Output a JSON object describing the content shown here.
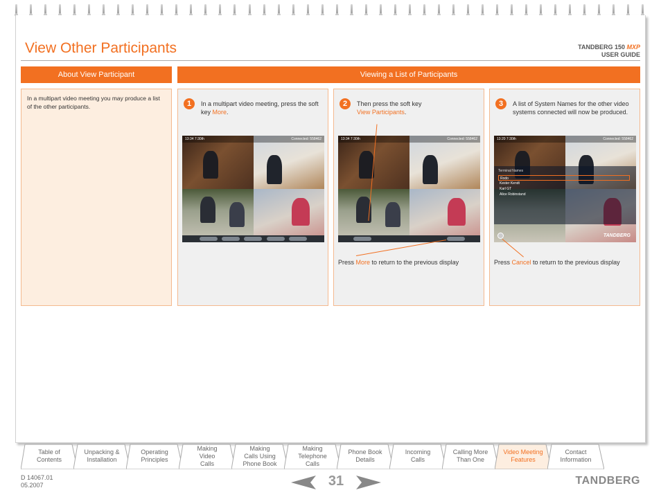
{
  "header": {
    "title": "View Other Participants",
    "brand_line1_prefix": "TANDBERG 150 ",
    "brand_line1_mxp": "MXP",
    "brand_line2": "USER GUIDE"
  },
  "left_panel": {
    "heading": "About View Participant",
    "text": "In a multipart video meeting you may produce a list of the other participants."
  },
  "right_panel": {
    "heading": "Viewing a List of Participants"
  },
  "steps": [
    {
      "number": "1",
      "text_before": "In a multipart video meeting, press the soft key ",
      "highlight": "More",
      "text_after": "."
    },
    {
      "number": "2",
      "text_before": "Then press the soft key ",
      "highlight": "View Participants",
      "text_after": ".",
      "after_before": "Press ",
      "after_highlight": "More",
      "after_after": " to return to the previous display"
    },
    {
      "number": "3",
      "text_before": "A list of System Names for the other video systems connected will now be produced.",
      "highlight": "",
      "text_after": "",
      "after_before": "Press ",
      "after_highlight": "Cancel",
      "after_after": " to return to the previous display"
    }
  ],
  "screens": {
    "status_left_1": "13:34  7:30th",
    "status_right": "Connected: 558462",
    "status_left_3": "13:20  7:30th",
    "terminal_names_label": "Terminal Names",
    "terminal_names": [
      "Rodo",
      "Kester Kendt",
      "Karl GT",
      "Alice Robinstand"
    ],
    "logo": "TANDBERG"
  },
  "nav_tabs": [
    {
      "label": "Table of\nContents",
      "active": false
    },
    {
      "label": "Unpacking &\nInstallation",
      "active": false
    },
    {
      "label": "Operating\nPrinciples",
      "active": false
    },
    {
      "label": "Making\nVideo\nCalls",
      "active": false
    },
    {
      "label": "Making\nCalls Using\nPhone Book",
      "active": false
    },
    {
      "label": "Making\nTelephone\nCalls",
      "active": false
    },
    {
      "label": "Phone Book\nDetails",
      "active": false
    },
    {
      "label": "Incoming\nCalls",
      "active": false
    },
    {
      "label": "Calling More\nThan One",
      "active": false
    },
    {
      "label": "Video Meeting\nFeatures",
      "active": true
    },
    {
      "label": "Contact\nInformation",
      "active": false
    }
  ],
  "footer": {
    "doc_id": "D 14067.01",
    "date": "05.2007",
    "page_number": "31",
    "logo": "TANDBERG"
  },
  "colors": {
    "accent": "#f27021",
    "panel_bg": "#fdeee0",
    "step_bg": "#f0f0f0"
  }
}
